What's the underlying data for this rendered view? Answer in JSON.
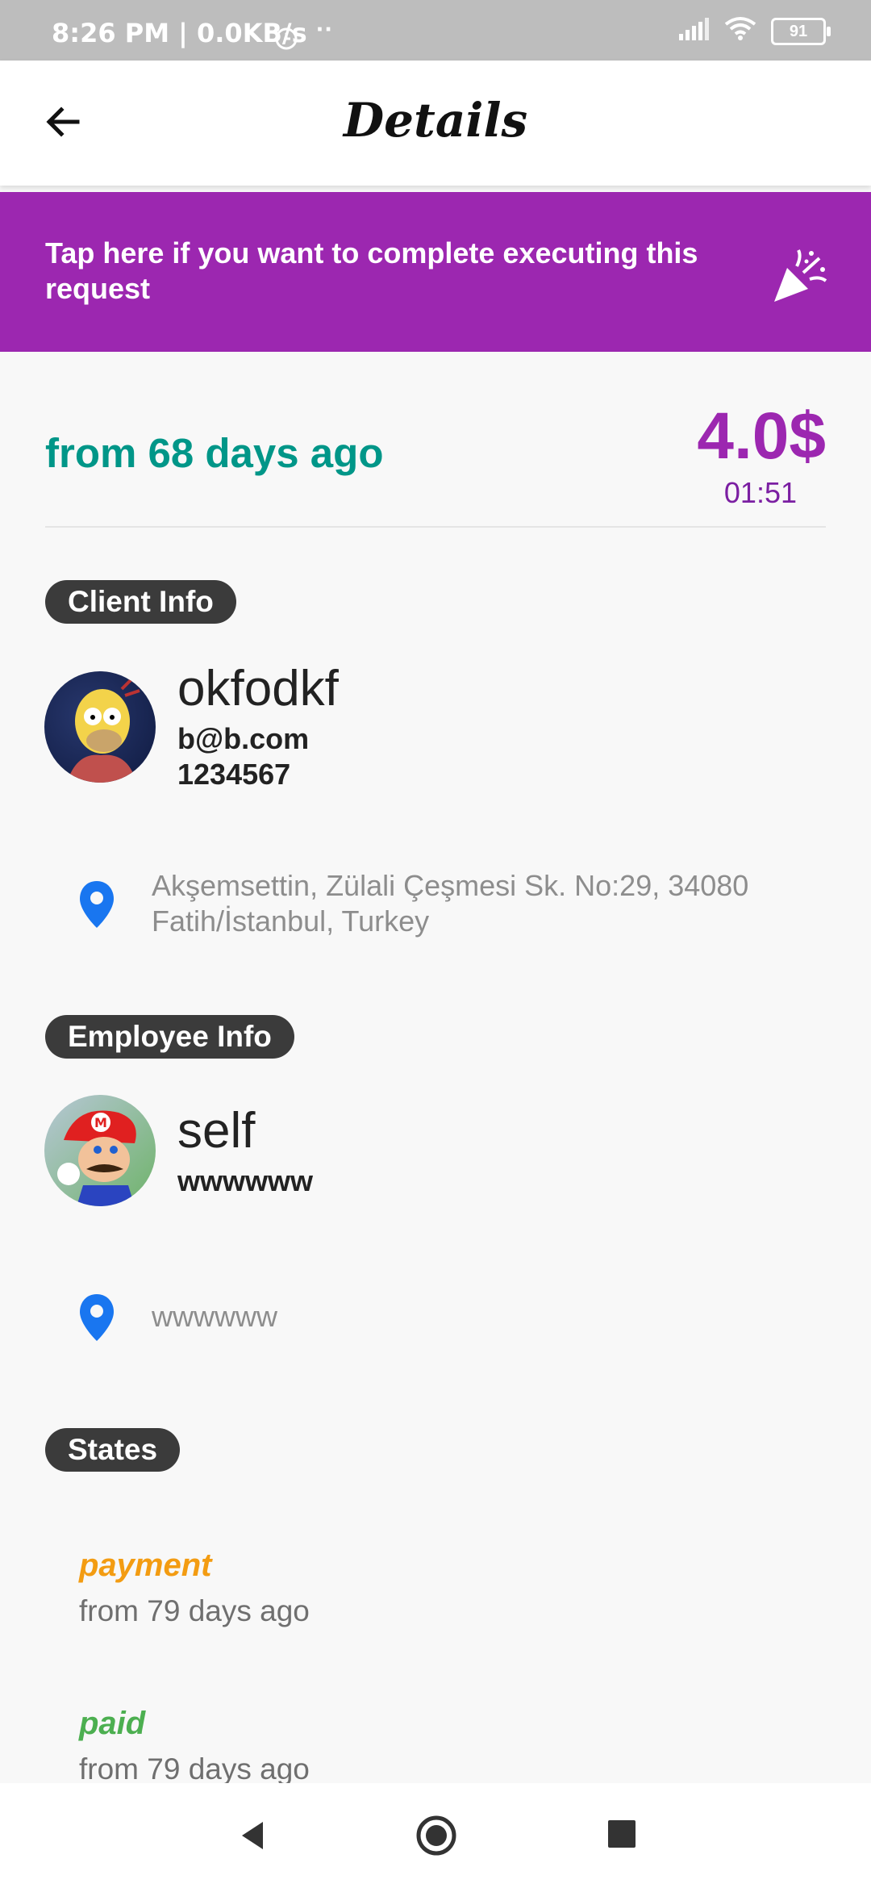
{
  "status_bar": {
    "time": "8:26 PM | 0.0KB/s",
    "dots": "··",
    "battery": "91",
    "icons": [
      "alarm-icon",
      "signal-icon",
      "wifi-icon",
      "battery-icon"
    ]
  },
  "app_bar": {
    "title": "Details",
    "back_icon": "arrow-left-icon"
  },
  "banner": {
    "text": "Tap here if you want to complete executing this request",
    "icon": "party-popper-icon",
    "color": "#9c27b0"
  },
  "summary": {
    "ago": "from 68 days ago",
    "price": "4.0$",
    "time": "01:51"
  },
  "client": {
    "section_label": "Client Info",
    "name": "okfodkf",
    "email": "b@b.com",
    "phone": "1234567",
    "address": "Akşemsettin, Zülali Çeşmesi Sk. No:29, 34080 Fatih/İstanbul, Turkey"
  },
  "employee": {
    "section_label": "Employee Info",
    "name": "self",
    "detail": "wwwwww",
    "address": "wwwwww"
  },
  "states": {
    "section_label": "States",
    "items": [
      {
        "label": "payment",
        "time": "from 79 days ago",
        "color": "#f39c12"
      },
      {
        "label": "paid",
        "time": "from 79 days ago",
        "color": "#4caf50"
      }
    ]
  },
  "colors": {
    "accent": "#9c27b0",
    "teal": "#009688",
    "pin": "#1976f0"
  }
}
